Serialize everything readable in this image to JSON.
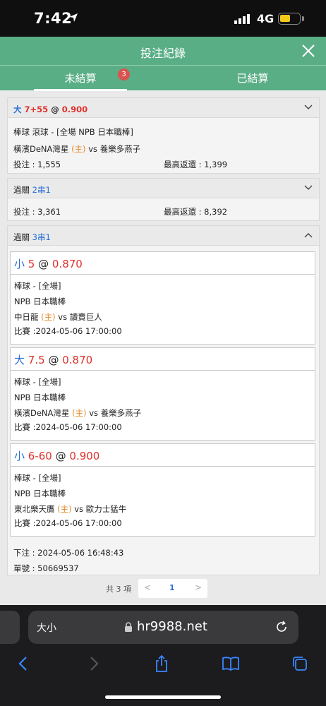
{
  "status": {
    "time": "7:42",
    "network": "4G"
  },
  "header": {
    "title": "投注紀錄"
  },
  "tabs": {
    "unsettled": "未結算",
    "badge": "3",
    "settled": "已結算"
  },
  "bet1": {
    "side": "大",
    "line": "7+55",
    "at": "@",
    "odds": "0.900",
    "sport": "棒球 滾球 - [全場 NPB 日本職棒]",
    "home": "橫濱DeNA灣星",
    "home_tag": "(主)",
    "vs": "vs",
    "away": "養樂多燕子",
    "stake": "投注 : 1,555",
    "max_return": "最高返還 : 1,399"
  },
  "bet2": {
    "type": "過關",
    "combo": "2串1",
    "stake": "投注 : 3,361",
    "max_return": "最高返還 : 8,392"
  },
  "bet3": {
    "type": "過關",
    "combo": "3串1",
    "legs": [
      {
        "side": "小",
        "line": "5",
        "at": "@",
        "odds": "0.870",
        "sport": "棒球 - [全場]",
        "league": "NPB 日本職棒",
        "home": "中日龍",
        "home_tag": "(主)",
        "vs": "vs",
        "away": "讀賣巨人",
        "match": "比賽 :2024-05-06 17:00:00"
      },
      {
        "side": "大",
        "line": "7.5",
        "at": "@",
        "odds": "0.870",
        "sport": "棒球 - [全場]",
        "league": "NPB 日本職棒",
        "home": "橫濱DeNA灣星",
        "home_tag": "(主)",
        "vs": "vs",
        "away": "養樂多燕子",
        "match": "比賽 :2024-05-06 17:00:00"
      },
      {
        "side": "小",
        "line": "6-60",
        "at": "@",
        "odds": "0.900",
        "sport": "棒球 - [全場]",
        "league": "NPB 日本職棒",
        "home": "東北樂天鷹",
        "home_tag": "(主)",
        "vs": "vs",
        "away": "歐力士猛牛",
        "match": "比賽 :2024-05-06 17:00:00"
      }
    ],
    "placed": "下注 : 2024-05-06 16:48:43",
    "order": "單號 : 50669537"
  },
  "pager": {
    "total": "共 3 項",
    "prev": "<",
    "page": "1",
    "next": ">"
  },
  "browser": {
    "text_size": "大小",
    "url": "hr9988.net"
  },
  "colors": {
    "brand_green": "#5aae85",
    "blue": "#2b6fd6",
    "red": "#e0302a",
    "orange": "#e8892a"
  }
}
